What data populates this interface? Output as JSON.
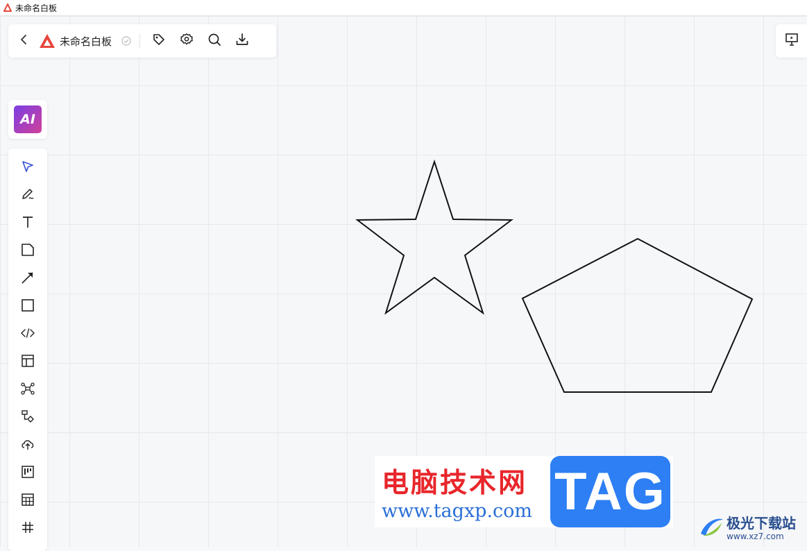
{
  "window": {
    "title": "未命名白板"
  },
  "toolbar": {
    "doc_title": "未命名白板",
    "icons": [
      "back-icon",
      "logo-icon",
      "saved-check-icon",
      "tag-icon",
      "gear-icon",
      "search-icon",
      "download-icon"
    ]
  },
  "present": {
    "icon": "presentation-icon"
  },
  "ai": {
    "label": "AI"
  },
  "tools": [
    {
      "name": "select-tool",
      "icon": "pointer-icon"
    },
    {
      "name": "pen-tool",
      "icon": "pen-icon"
    },
    {
      "name": "text-tool",
      "icon": "text-icon"
    },
    {
      "name": "sticky-note-tool",
      "icon": "note-icon"
    },
    {
      "name": "arrow-tool",
      "icon": "arrow-icon"
    },
    {
      "name": "rectangle-tool",
      "icon": "rectangle-icon"
    },
    {
      "name": "code-tool",
      "icon": "code-icon"
    },
    {
      "name": "layout-tool",
      "icon": "layout-icon"
    },
    {
      "name": "mindmap-tool",
      "icon": "mindmap-icon"
    },
    {
      "name": "flowchart-tool",
      "icon": "flowchart-icon"
    },
    {
      "name": "upload-tool",
      "icon": "upload-icon"
    },
    {
      "name": "kanban-tool",
      "icon": "kanban-icon"
    },
    {
      "name": "table-tool",
      "icon": "table-icon"
    },
    {
      "name": "frame-tool",
      "icon": "frame-icon"
    }
  ],
  "shapes": [
    "star",
    "pentagon"
  ],
  "watermark": {
    "cn": "电脑技术网",
    "url": "www.tagxp.com",
    "tag": "TAG"
  },
  "corner": {
    "cn": "极光下载站",
    "url": "www.xz7.com"
  },
  "colors": {
    "accent_red": "#e8453c",
    "ai_gradient_start": "#7b3fe4",
    "ai_gradient_end": "#d0409a",
    "tag_blue": "#2d7ff3"
  }
}
